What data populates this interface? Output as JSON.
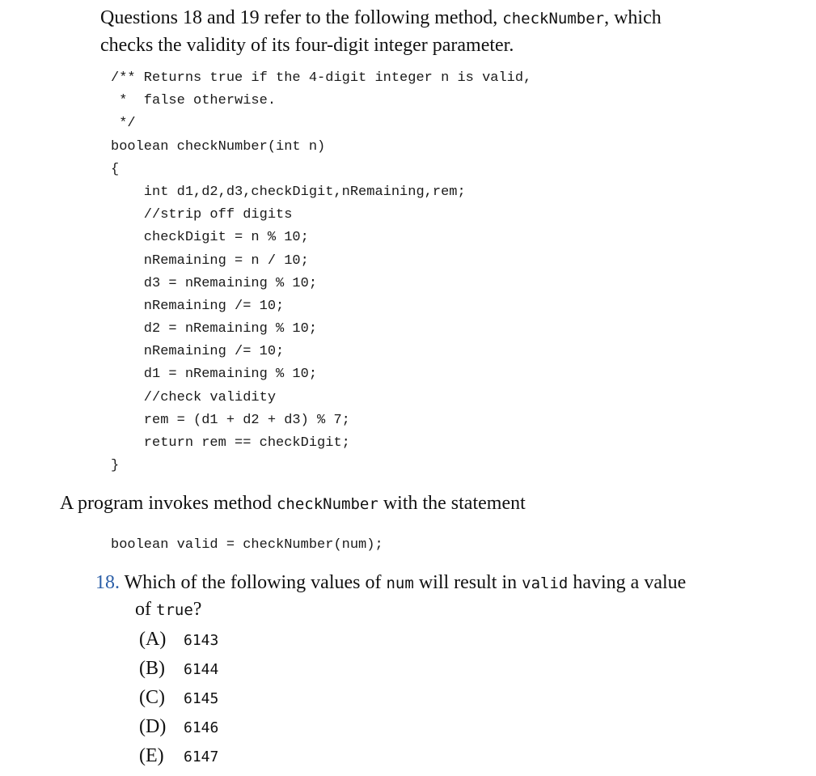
{
  "intro": {
    "part1": "Questions 18 and 19 refer to the following method, ",
    "method_name": "checkNumber",
    "part2": ", which",
    "line2": "checks the validity of its four-digit integer parameter."
  },
  "code_lines": [
    "/** Returns true if the 4-digit integer n is valid,",
    " *  false otherwise.",
    " */",
    "boolean checkNumber(int n)",
    "{",
    "    int d1,d2,d3,checkDigit,nRemaining,rem;",
    "    //strip off digits",
    "    checkDigit = n % 10;",
    "    nRemaining = n / 10;",
    "    d3 = nRemaining % 10;",
    "    nRemaining /= 10;",
    "    d2 = nRemaining % 10;",
    "    nRemaining /= 10;",
    "    d1 = nRemaining % 10;",
    "    //check validity",
    "    rem = (d1 + d2 + d3) % 7;",
    "    return rem == checkDigit;",
    "}"
  ],
  "invoke": {
    "part1": "A program invokes method ",
    "method_name": "checkNumber",
    "part2": " with the statement"
  },
  "statement": "boolean valid = checkNumber(num);",
  "question": {
    "number": "18.",
    "part1": " Which of the following values of ",
    "code1": "num",
    "part2": " will result in ",
    "code2": "valid",
    "part3": " having a value",
    "line2_prefix": "of ",
    "code3": "true",
    "line2_suffix": "?"
  },
  "choices": [
    {
      "letter": "(A)",
      "value": "6143"
    },
    {
      "letter": "(B)",
      "value": "6144"
    },
    {
      "letter": "(C)",
      "value": "6145"
    },
    {
      "letter": "(D)",
      "value": "6146"
    },
    {
      "letter": "(E)",
      "value": "6147"
    }
  ],
  "colors": {
    "question_number": "#2c5fa8",
    "text": "#111111"
  }
}
